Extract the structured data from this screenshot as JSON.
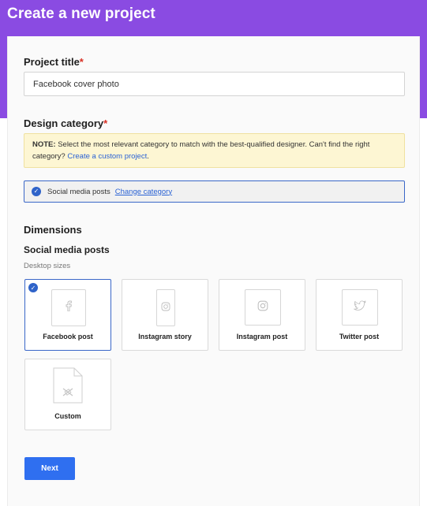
{
  "header": {
    "title": "Create a new project"
  },
  "project_title": {
    "label": "Project title",
    "required_mark": "*",
    "value": "Facebook cover photo"
  },
  "design_category": {
    "label": "Design category",
    "required_mark": "*",
    "note_prefix": "NOTE:",
    "note_text": " Select the most relevant category to match with the best-qualified designer. Can't find the right category? ",
    "note_link": "Create a custom project",
    "note_suffix": ".",
    "selected": "Social media posts",
    "change_link": "Change category"
  },
  "dimensions": {
    "heading": "Dimensions",
    "group_title": "Social media posts",
    "subtitle": "Desktop sizes",
    "options": [
      {
        "label": "Facebook post",
        "icon": "facebook-icon",
        "selected": true
      },
      {
        "label": "Instagram story",
        "icon": "instagram-icon",
        "selected": false
      },
      {
        "label": "Instagram post",
        "icon": "instagram-icon",
        "selected": false
      },
      {
        "label": "Twitter post",
        "icon": "twitter-icon",
        "selected": false
      },
      {
        "label": "Custom",
        "icon": "custom-icon",
        "selected": false
      }
    ]
  },
  "actions": {
    "next_label": "Next"
  },
  "colors": {
    "header_bg": "#8a4be2",
    "accent": "#2f63c9",
    "button": "#2f6ff0",
    "note_bg": "#fdf6d3"
  }
}
